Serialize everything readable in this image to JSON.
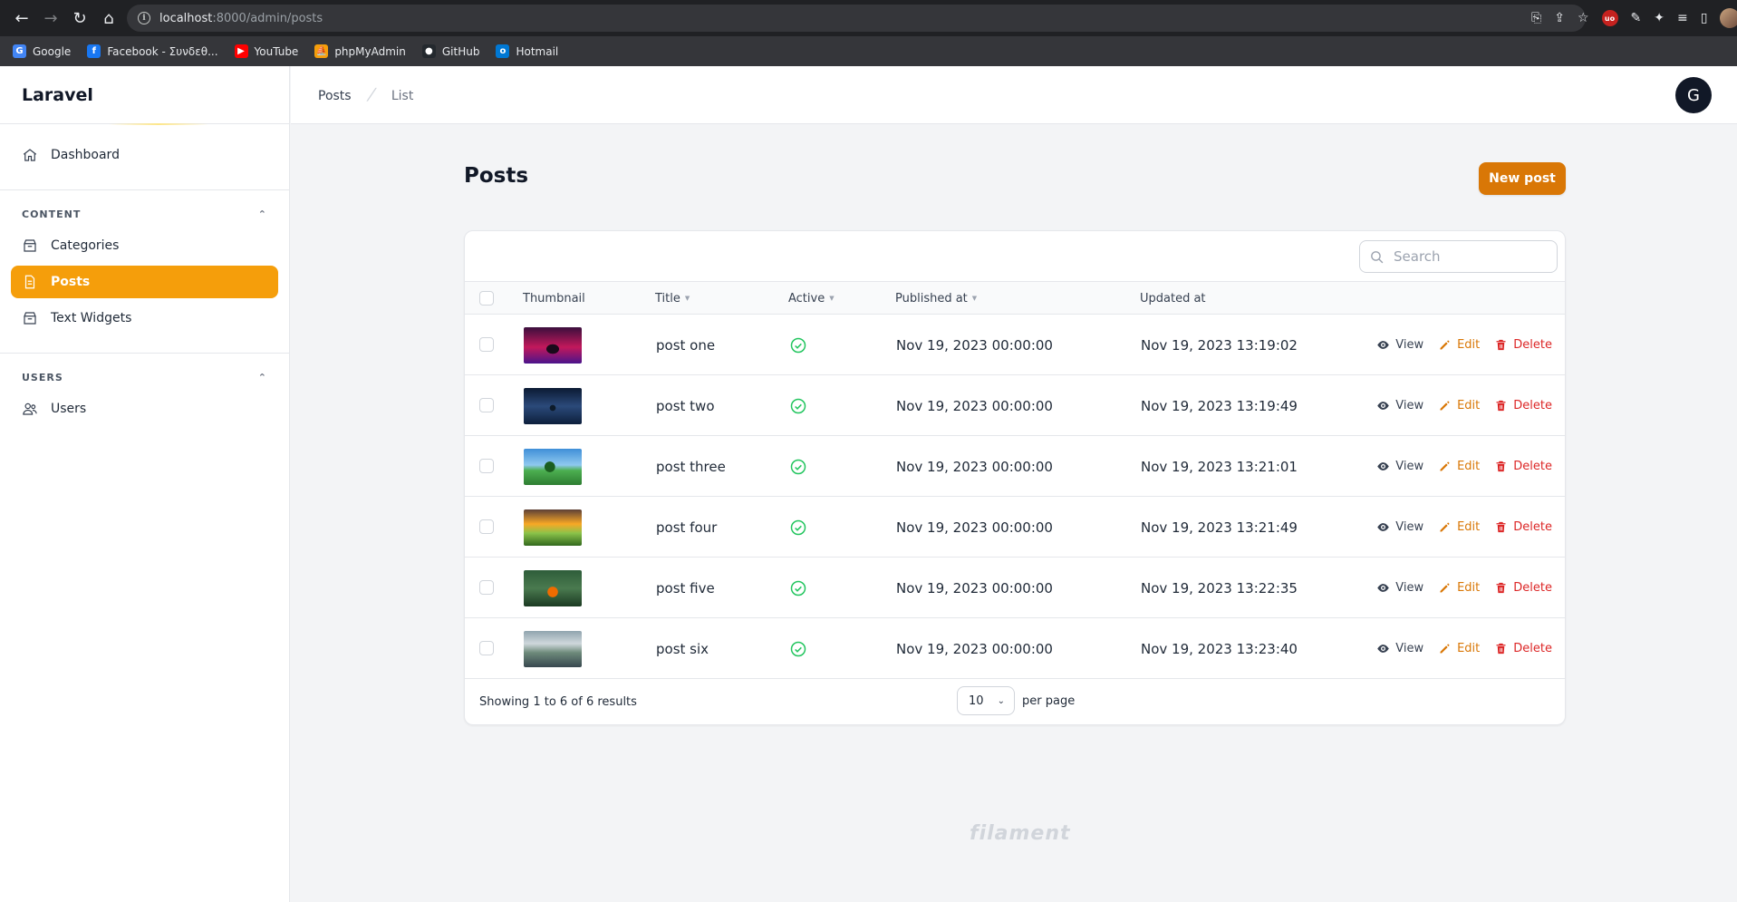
{
  "browser": {
    "url_host": "localhost",
    "url_path": ":8000/admin/posts",
    "bookmarks": [
      {
        "label": "Google",
        "color": "#4285f4",
        "glyph": "G"
      },
      {
        "label": "Facebook - Συνδεθ...",
        "color": "#1877f2",
        "glyph": "f"
      },
      {
        "label": "YouTube",
        "color": "#ff0000",
        "glyph": "▶"
      },
      {
        "label": "phpMyAdmin",
        "color": "#f59e0b",
        "glyph": "⛵"
      },
      {
        "label": "GitHub",
        "color": "#24292e",
        "glyph": "●"
      },
      {
        "label": "Hotmail",
        "color": "#0078d4",
        "glyph": "o"
      }
    ],
    "extension_label": "uo"
  },
  "sidebar": {
    "brand": "Laravel",
    "dashboard": "Dashboard",
    "groups": [
      {
        "label": "CONTENT",
        "items": [
          "Categories",
          "Posts",
          "Text Widgets"
        ]
      },
      {
        "label": "USERS",
        "items": [
          "Users"
        ]
      }
    ],
    "active_item": "Posts"
  },
  "topbar": {
    "breadcrumb": [
      "Posts",
      "List"
    ],
    "avatar_initial": "G"
  },
  "page": {
    "title": "Posts",
    "new_button": "New post"
  },
  "table": {
    "search_placeholder": "Search",
    "columns": [
      "Thumbnail",
      "Title",
      "Active",
      "Published at",
      "Updated at"
    ],
    "rows": [
      {
        "title": "post one",
        "published": "Nov 19, 2023 00:00:00",
        "updated": "Nov 19, 2023 13:19:02"
      },
      {
        "title": "post two",
        "published": "Nov 19, 2023 00:00:00",
        "updated": "Nov 19, 2023 13:19:49"
      },
      {
        "title": "post three",
        "published": "Nov 19, 2023 00:00:00",
        "updated": "Nov 19, 2023 13:21:01"
      },
      {
        "title": "post four",
        "published": "Nov 19, 2023 00:00:00",
        "updated": "Nov 19, 2023 13:21:49"
      },
      {
        "title": "post five",
        "published": "Nov 19, 2023 00:00:00",
        "updated": "Nov 19, 2023 13:22:35"
      },
      {
        "title": "post six",
        "published": "Nov 19, 2023 00:00:00",
        "updated": "Nov 19, 2023 13:23:40"
      }
    ],
    "actions": {
      "view": "View",
      "edit": "Edit",
      "delete": "Delete"
    },
    "footer": {
      "showing": "Showing 1 to 6 of 6 results",
      "per_page_value": "10",
      "per_page_label": "per page"
    }
  },
  "footer_logo": "filament",
  "colors": {
    "primary": "#f59e0b",
    "primary_dark": "#d97706",
    "success": "#22c55e",
    "danger": "#dc2626"
  }
}
